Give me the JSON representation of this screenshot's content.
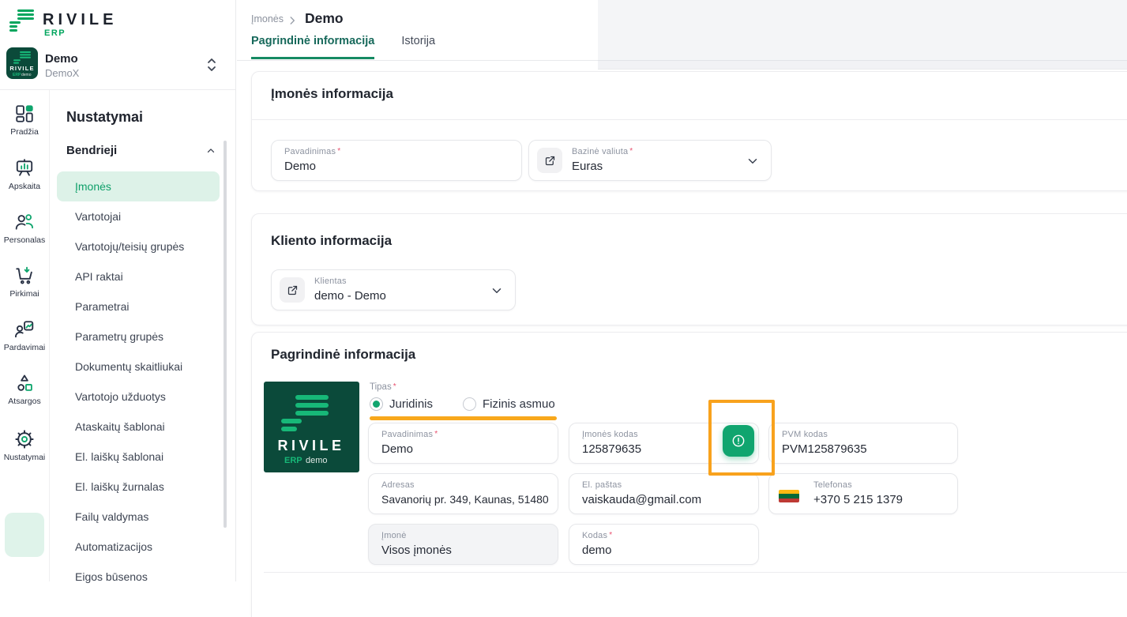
{
  "brand": {
    "name": "RIVILE",
    "sub": "ERP"
  },
  "company": {
    "name": "Demo",
    "code": "DemoX"
  },
  "logo_tile": {
    "name": "RIVILE",
    "erp": "ERP",
    "suffix": "demo"
  },
  "rail": {
    "items": [
      "Pradžia",
      "Apskaita",
      "Personalas",
      "Pirkimai",
      "Pardavimai",
      "Atsargos",
      "Nustatymai"
    ]
  },
  "sidebar": {
    "heading": "Nustatymai",
    "group": "Bendrieji",
    "items": [
      "Įmonės",
      "Vartotojai",
      "Vartotojų/teisių grupės",
      "API raktai",
      "Parametrai",
      "Parametrų grupės",
      "Dokumentų skaitliukai",
      "Vartotojo užduotys",
      "Ataskaitų šablonai",
      "El. laiškų šablonai",
      "El. laiškų žurnalas",
      "Failų valdymas",
      "Automatizacijos",
      "Eigos būsenos"
    ]
  },
  "breadcrumb": {
    "parent": "Įmonės",
    "current": "Demo"
  },
  "tabs": [
    "Pagrindinė informacija",
    "Istorija"
  ],
  "marks": {
    "required": "*"
  },
  "cards": {
    "company": {
      "title": "Įmonės informacija",
      "fields": {
        "pavadinimas": {
          "label": "Pavadinimas",
          "value": "Demo"
        },
        "valiuta": {
          "label": "Bazinė valiuta",
          "value": "Euras"
        }
      }
    },
    "client": {
      "title": "Kliento informacija",
      "fields": {
        "klientas": {
          "label": "Klientas",
          "value": "demo - Demo"
        }
      }
    },
    "main": {
      "title": "Pagrindinė informacija",
      "tipas": {
        "label": "Tipas",
        "options": [
          "Juridinis",
          "Fizinis asmuo"
        ],
        "selected": "Juridinis"
      },
      "fields": {
        "pavadinimas": {
          "label": "Pavadinimas",
          "value": "Demo"
        },
        "imones_kodas": {
          "label": "Įmonės kodas",
          "value": "125879635"
        },
        "pvm_kodas": {
          "label": "PVM kodas",
          "value": "PVM125879635"
        },
        "adresas": {
          "label": "Adresas",
          "value": "Savanorių pr. 349, Kaunas, 51480"
        },
        "el_pastas": {
          "label": "El. paštas",
          "value": "vaiskauda@gmail.com"
        },
        "telefonas": {
          "label": "Telefonas",
          "value": "+370 5 215 1379"
        },
        "imone": {
          "label": "Įmonė",
          "value": "Visos įmonės"
        },
        "kodas": {
          "label": "Kodas",
          "value": "demo"
        }
      }
    }
  },
  "colors": {
    "brand_green": "#00a55d",
    "accent_green": "#10a56f",
    "active_mint": "#ddf2e8",
    "annotation_orange": "#f8a21d",
    "logo_bg": "#0b4a3a",
    "flag_lt": [
      "#fdb913",
      "#046a38",
      "#be3a34"
    ]
  }
}
